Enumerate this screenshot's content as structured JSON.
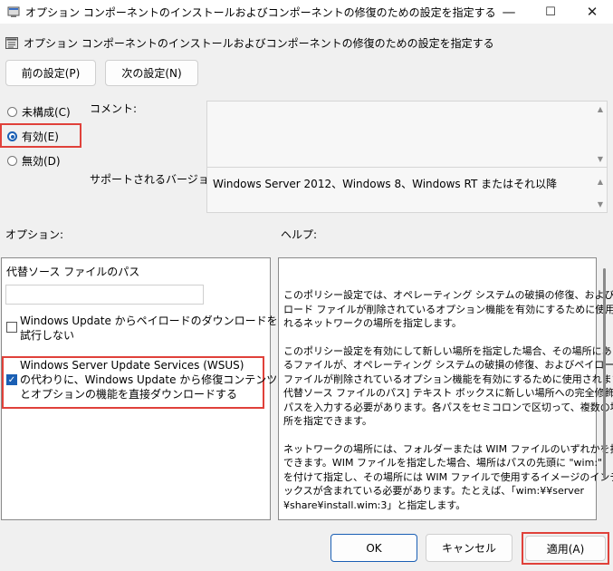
{
  "window": {
    "title": "オプション コンポーネントのインストールおよびコンポーネントの修復のための設定を指定する",
    "minimize_glyph": "—",
    "maximize_glyph": "☐",
    "close_glyph": "✕"
  },
  "header": {
    "title": "オプション コンポーネントのインストールおよびコンポーネントの修復のための設定を指定する"
  },
  "nav": {
    "prev_label": "前の設定(P)",
    "next_label": "次の設定(N)"
  },
  "state": {
    "options": [
      {
        "label": "未構成(C)",
        "selected": false
      },
      {
        "label": "有効(E)",
        "selected": true
      },
      {
        "label": "無効(D)",
        "selected": false
      }
    ]
  },
  "comment": {
    "label": "コメント:",
    "value": ""
  },
  "supported": {
    "label": "サポートされるバージョン:",
    "value": "Windows Server 2012、Windows 8、Windows RT またはそれ以降"
  },
  "options_section": {
    "label": "オプション:",
    "alt_source_label": "代替ソース ファイルのパス",
    "alt_source_value": "",
    "cb1_lines": [
      "Windows  Update からペイロードのダウンロードを",
      "試行しない"
    ],
    "cb1_checked": false,
    "cb2_lines": [
      "Windows Server Update Services (WSUS)",
      "の代わりに、Windows  Update から修復コンテンツ",
      "とオプションの機能を直接ダウンロードする"
    ],
    "cb2_checked": true
  },
  "help_section": {
    "label": "ヘルプ:",
    "paragraphs": [
      [
        "このポリシー設定では、オペレーティング システムの破損の修復、およびペイ",
        "ロード ファイルが削除されているオプション機能を有効にするために使用さ",
        "れるネットワークの場所を指定します。"
      ],
      [
        "このポリシー設定を有効にして新しい場所を指定した場合、その場所にあ",
        "るファイルが、オペレーティング システムの破損の修復、およびペイロード",
        "ファイルが削除されているオプション機能を有効にするために使用されます。[",
        "代替ソース ファイルのパス] テキスト ボックスに新しい場所への完全修飾",
        "パスを入力する必要があります。各パスをセミコロンで区切って、複数の場",
        "所を指定できます。"
      ],
      [
        "ネットワークの場所には、フォルダーまたは WIM ファイルのいずれかを指定",
        "できます。WIM ファイルを指定した場合、場所はパスの先頭に \"wim:\"",
        "を付けて指定し、その場所には WIM ファイルで使用するイメージのインデ",
        "ックスが含まれている必要があります。たとえば、「wim:¥¥server",
        "¥share¥install.wim:3」と指定します。"
      ]
    ]
  },
  "footer": {
    "ok_label": "OK",
    "cancel_label": "キャンセル",
    "apply_label": "適用(A)"
  },
  "colors": {
    "accent": "#1a5fb4",
    "highlight": "#e0413a"
  }
}
